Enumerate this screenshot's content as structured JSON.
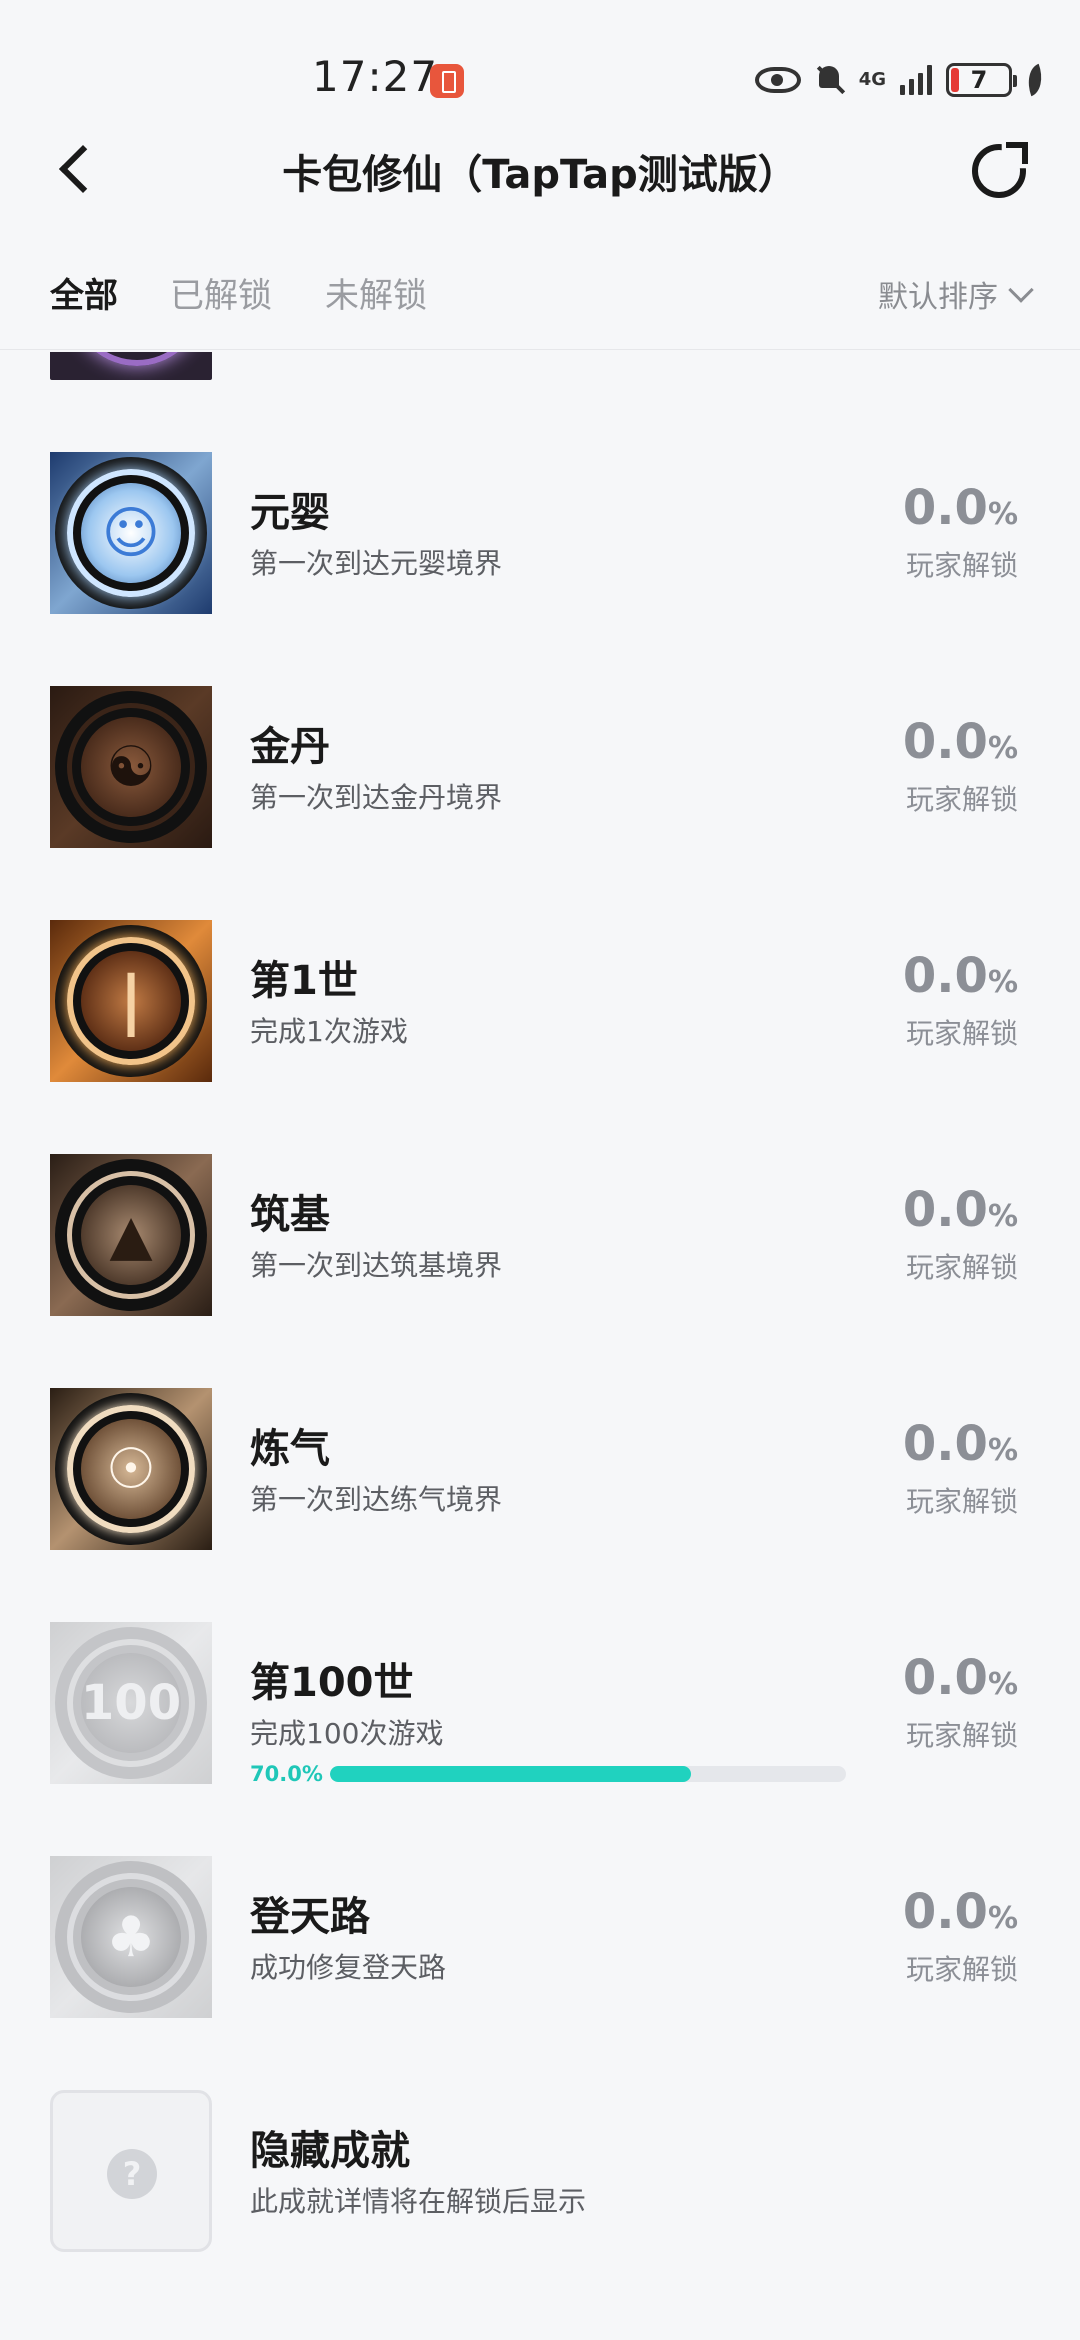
{
  "status_bar": {
    "time": "17:27",
    "network": "4G",
    "battery": "7"
  },
  "header": {
    "title": "卡包修仙（TapTap测试版）"
  },
  "tabs": [
    {
      "label": "全部",
      "active": true
    },
    {
      "label": "已解锁",
      "active": false
    },
    {
      "label": "未解锁",
      "active": false
    }
  ],
  "sort": {
    "label": "默认排序"
  },
  "achievements": [
    {
      "title": "元婴",
      "desc": "第一次到达元婴境界",
      "rate": "0.0",
      "pct": "%",
      "rate_label": "玩家解锁",
      "icon": "infant-spirit-icon"
    },
    {
      "title": "金丹",
      "desc": "第一次到达金丹境界",
      "rate": "0.0",
      "pct": "%",
      "rate_label": "玩家解锁",
      "icon": "golden-core-icon"
    },
    {
      "title": "第1世",
      "desc": "完成1次游戏",
      "rate": "0.0",
      "pct": "%",
      "rate_label": "玩家解锁",
      "icon": "first-life-icon"
    },
    {
      "title": "筑基",
      "desc": "第一次到达筑基境界",
      "rate": "0.0",
      "pct": "%",
      "rate_label": "玩家解锁",
      "icon": "foundation-icon"
    },
    {
      "title": "炼气",
      "desc": "第一次到达练气境界",
      "rate": "0.0",
      "pct": "%",
      "rate_label": "玩家解锁",
      "icon": "qi-refining-icon"
    },
    {
      "title": "第100世",
      "desc": "完成100次游戏",
      "rate": "0.0",
      "pct": "%",
      "rate_label": "玩家解锁",
      "icon": "hundredth-life-icon",
      "progress_label": "70.0%",
      "progress": 0.7,
      "icon_glyph": "100"
    },
    {
      "title": "登天路",
      "desc": "成功修复登天路",
      "rate": "0.0",
      "pct": "%",
      "rate_label": "玩家解锁",
      "icon": "heaven-road-icon"
    }
  ],
  "hidden": {
    "title": "隐藏成就",
    "desc": "此成就详情将在解锁后显示"
  },
  "colors": {
    "accent": "#20d2bf",
    "text_secondary": "#8c8f96",
    "background": "#f6f7f9"
  }
}
